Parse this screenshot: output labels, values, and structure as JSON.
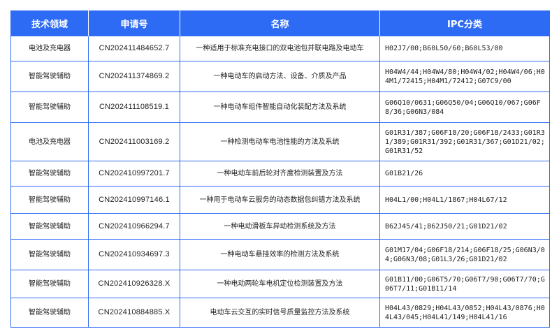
{
  "colors": {
    "accent": "#2e6bf5",
    "header_text": "#ffffff",
    "body_text": "#222222"
  },
  "table": {
    "headers": [
      "技术领域",
      "申请号",
      "名称",
      "IPC分类"
    ],
    "rows": [
      {
        "field": "电池及充电器",
        "app_no": "CN202411484652.7",
        "name": "一种适用于标准充电接口的双电池包并联电路及电动车",
        "ipc": "H02J7/00;B60L50/60;B60L53/00"
      },
      {
        "field": "智能驾驶辅助",
        "app_no": "CN202411374869.2",
        "name": "一种电动车的启动方法、设备、介质及产品",
        "ipc": "H04W4/44;H04W4/80;H04W4/02;H04W4/06;H04M1/72415;H04M1/72412;G07C9/00"
      },
      {
        "field": "智能驾驶辅助",
        "app_no": "CN202411108519.1",
        "name": "一种电动车组件智能自动化装配方法及系统",
        "ipc": "G06Q10/0631;G06Q50/04;G06Q10/067;G06F8/36;G06N3/084"
      },
      {
        "field": "电池及充电器",
        "app_no": "CN202411003169.2",
        "name": "一种检测电动车电池性能的方法及系统",
        "ipc": "G01R31/387;G06F18/20;G06F18/2433;G01R31/389;G01R31/392;G01R31/367;G01D21/02;G01R31/52"
      },
      {
        "field": "智能驾驶辅助",
        "app_no": "CN202410997201.7",
        "name": "一种电动车前后轮对齐度检测装置及方法",
        "ipc": "G01B21/26"
      },
      {
        "field": "智能驾驶辅助",
        "app_no": "CN202410997146.1",
        "name": "一种用于电动车云服务的动态数据包纠错方法及系统",
        "ipc": "H04L1/00;H04L1/1867;H04L67/12"
      },
      {
        "field": "智能驾驶辅助",
        "app_no": "CN202410966294.7",
        "name": "一种电动滑板车异动检测系统及方法",
        "ipc": "B62J45/41;B62J50/21;G01D21/02"
      },
      {
        "field": "智能驾驶辅助",
        "app_no": "CN202410934697.3",
        "name": "一种电动车悬挂效率的检测方法及系统",
        "ipc": "G01M17/04;G06F18/214;G06F18/25;G06N3/04;G06N3/08;G01L3/26;G01D21/02"
      },
      {
        "field": "智能驾驶辅助",
        "app_no": "CN202410926328.X",
        "name": "一种电动两轮车电机定位检测装置及方法",
        "ipc": "G01B11/00;G06T5/70;G06T7/90;G06T7/70;G06T7/11;G01B11/14"
      },
      {
        "field": "智能驾驶辅助",
        "app_no": "CN202410884885.X",
        "name": "电动车云交互的实时信号质量监控方法及系统",
        "ipc": "H04L43/0829;H04L43/0852;H04L43/0876;H04L43/045;H04L41/149;H04L41/16"
      }
    ]
  }
}
